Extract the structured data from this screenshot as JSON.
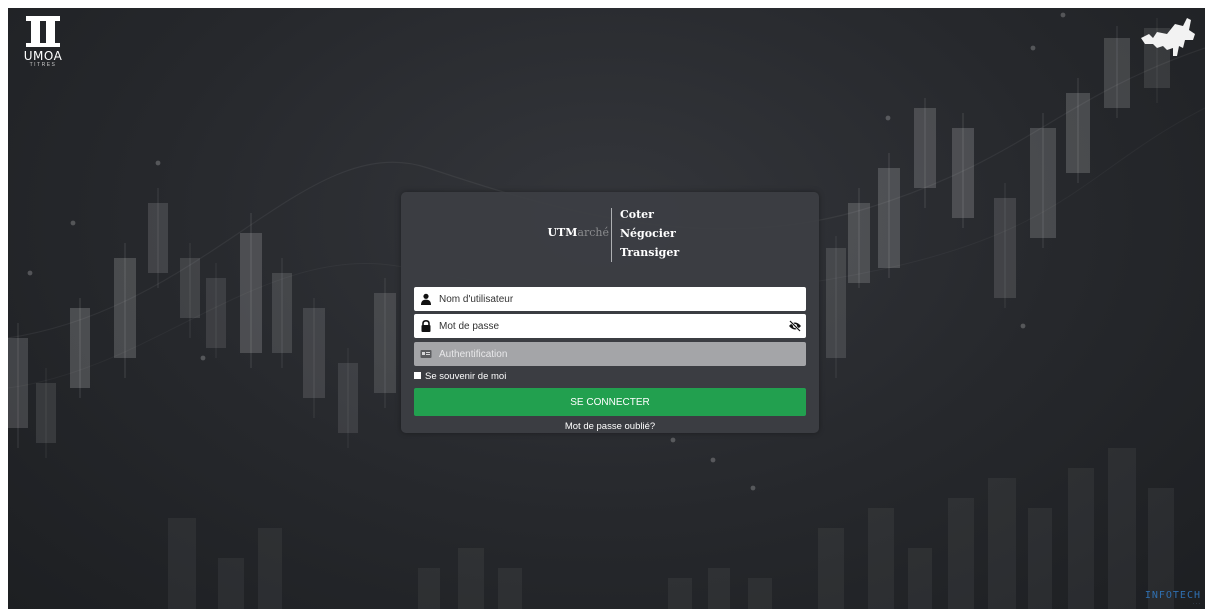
{
  "logo": {
    "name": "UMOA",
    "sub": "TITRES"
  },
  "brand_bottom": {
    "name": "INFOTECH",
    "sub": "···"
  },
  "card": {
    "brand_prefix": "UTM",
    "brand_suffix": "arché",
    "tagline": [
      "Coter",
      "Négocier",
      "Transiger"
    ]
  },
  "form": {
    "username_placeholder": "Nom d'utilisateur",
    "password_placeholder": "Mot de passe",
    "auth_placeholder": "Authentification",
    "remember_label": "Se souvenir de moi",
    "submit_label": "SE CONNECTER",
    "forgot_label": "Mot de passe oublié?"
  },
  "colors": {
    "background": "#26282c",
    "card": "#3c3e43",
    "accent_button": "#22a04f",
    "disabled_field": "#a4a5a8",
    "brand_blue": "#2f6fb0"
  },
  "icons": {
    "username": "user-icon",
    "password": "lock-icon",
    "auth": "id-card-icon",
    "toggle": "eye-slash-icon",
    "corner": "map-icon"
  }
}
